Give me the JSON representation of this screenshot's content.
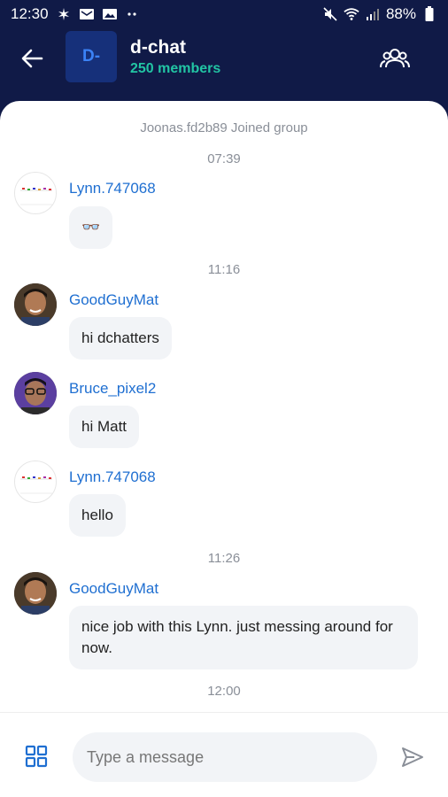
{
  "status": {
    "time": "12:30",
    "battery": "88%"
  },
  "header": {
    "avatar_text": "D-",
    "title": "d-chat",
    "members": "250 members",
    "icons": [
      "back-arrow-icon",
      "members-icon"
    ]
  },
  "chat": {
    "system_message": "Joonas.fd2b89 Joined group",
    "timestamps": [
      "07:39",
      "11:16",
      "11:26",
      "12:00"
    ],
    "messages": [
      {
        "sender": "Lynn.747068",
        "text": "👓"
      },
      {
        "sender": "GoodGuyMat",
        "text": "hi dchatters"
      },
      {
        "sender": "Bruce_pixel2",
        "text": "hi Matt"
      },
      {
        "sender": "Lynn.747068",
        "text": "hello"
      },
      {
        "sender": "GoodGuyMat",
        "text": "nice job with this Lynn. just messing around for now."
      }
    ]
  },
  "composer": {
    "placeholder": "Type a message",
    "icons": [
      "apps-grid-icon",
      "send-icon"
    ]
  },
  "colors": {
    "header_bg": "#101a47",
    "accent_blue": "#1f6fd1",
    "members_green": "#22c5a4"
  }
}
